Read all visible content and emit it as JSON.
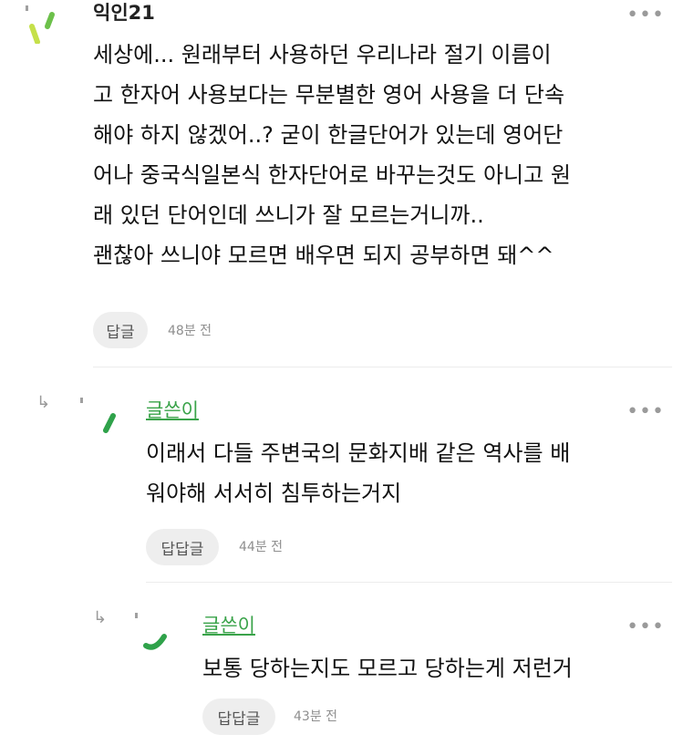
{
  "comments": [
    {
      "author": "익인21",
      "text": "세상에... 원래부터 사용하던 우리나라 절기 이름이\n고 한자어 사용보다는 무분별한 영어 사용을 더 단속\n해야 하지 않겠어..? 굳이 한글단어가 있는데 영어단\n어나 중국식일본식 한자단어로 바꾸는것도 아니고 원\n래 있던 단어인데 쓰니가 잘 모르는거니까..\n괜찮아 쓰니야 모르면 배우면 되지 공부하면 돼^^",
      "reply_label": "답글",
      "time": "48분 전",
      "more": "•••"
    },
    {
      "author": "글쓴이",
      "text": "이래서 다들 주변국의 문화지배 같은 역사를 배\n워야해 서서히 침투하는거지",
      "reply_label": "답답글",
      "time": "44분 전",
      "more": "•••"
    },
    {
      "author": "글쓴이",
      "text": "보통 당하는지도 모르고 당하는게 저런거",
      "reply_label": "답답글",
      "time": "43분 전",
      "more": "•••"
    }
  ],
  "reply_arrow": "↳",
  "colors": {
    "avatar_green": "#8ac926",
    "author_op": "#3aa34a",
    "button_bg": "#eeeeee"
  }
}
